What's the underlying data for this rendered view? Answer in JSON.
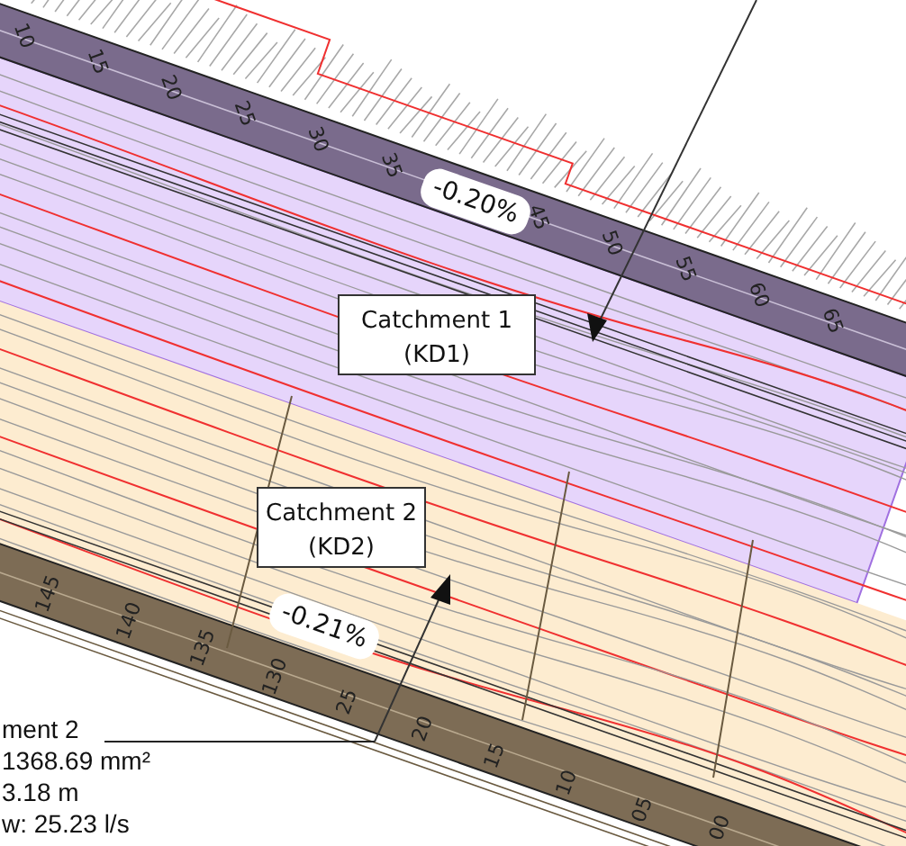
{
  "drawing": {
    "top_road_stations": [
      "10",
      "15",
      "20",
      "25",
      "30",
      "35",
      "45",
      "50",
      "55",
      "60",
      "65"
    ],
    "bottom_road_stations": [
      "145",
      "140",
      "135",
      "130",
      "25",
      "20",
      "15",
      "10",
      "05",
      "00"
    ],
    "grade_labels": [
      "-0.20%",
      "-0.21%"
    ],
    "catchments": [
      {
        "name": "Catchment 1",
        "code": "(KD1)",
        "color": "#e6d5fb"
      },
      {
        "name": "Catchment 2",
        "code": "(KD2)",
        "color": "#fdecd0"
      }
    ],
    "info_block": [
      "ment 2",
      "1368.69 mm²",
      "3.18 m",
      "w: 25.23 l/s"
    ]
  }
}
